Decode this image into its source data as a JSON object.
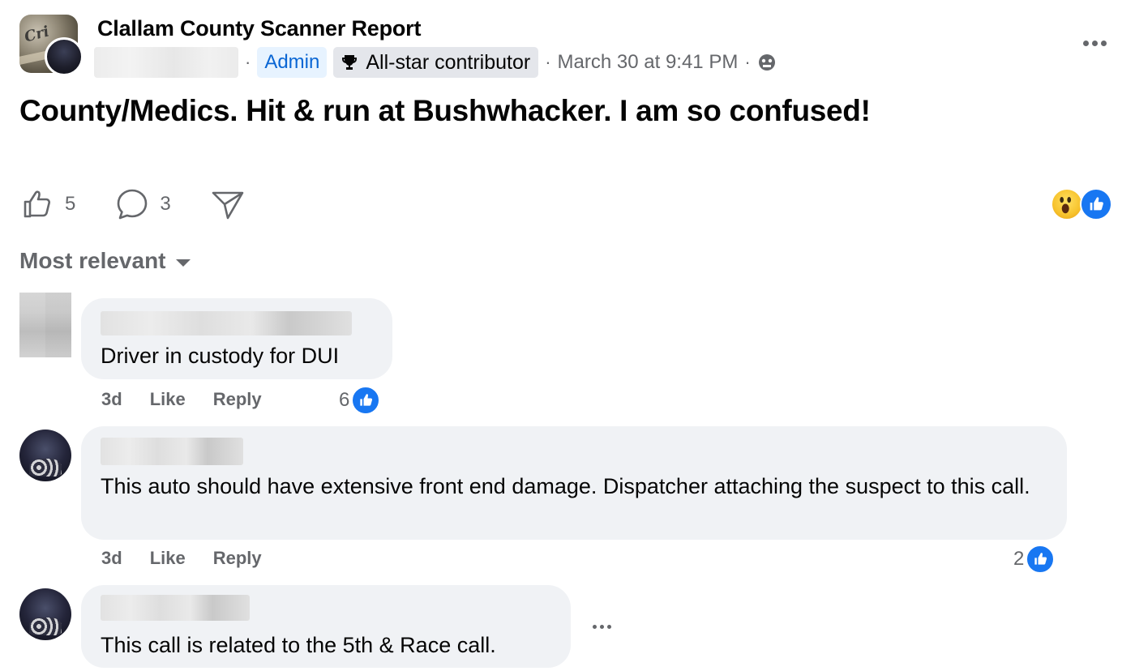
{
  "post": {
    "group_name": "Clallam County Scanner Report",
    "meta_separator": "·",
    "admin_label": "Admin",
    "contributor_label": "All-star contributor",
    "date": "March 30 at 9:41 PM",
    "text": "County/Medics. Hit & run at Bushwhacker. I am so confused!",
    "like_count": "5",
    "comment_count": "3",
    "icons": {
      "like": "thumbs-up-icon",
      "comment": "comment-bubble-icon",
      "share": "share-icon",
      "audience": "globe-icon",
      "more": "more-options-icon",
      "trophy": "trophy-icon"
    },
    "reactions": [
      "wow",
      "like"
    ]
  },
  "sort": {
    "label": "Most relevant"
  },
  "comments": [
    {
      "text": "Driver in custody for DUI",
      "time": "3d",
      "like_label": "Like",
      "reply_label": "Reply",
      "reaction_count": "6"
    },
    {
      "text": "This auto should have extensive front end damage. Dispatcher attaching the suspect to this call.",
      "time": "3d",
      "like_label": "Like",
      "reply_label": "Reply",
      "reaction_count": "2"
    },
    {
      "text": "This call is related to the 5th & Race call."
    }
  ],
  "colors": {
    "accent": "#1877f2",
    "secondary_text": "#65676b",
    "bubble": "#f0f2f5",
    "admin_bg": "#e7f3ff",
    "admin_text": "#0a66d4"
  }
}
